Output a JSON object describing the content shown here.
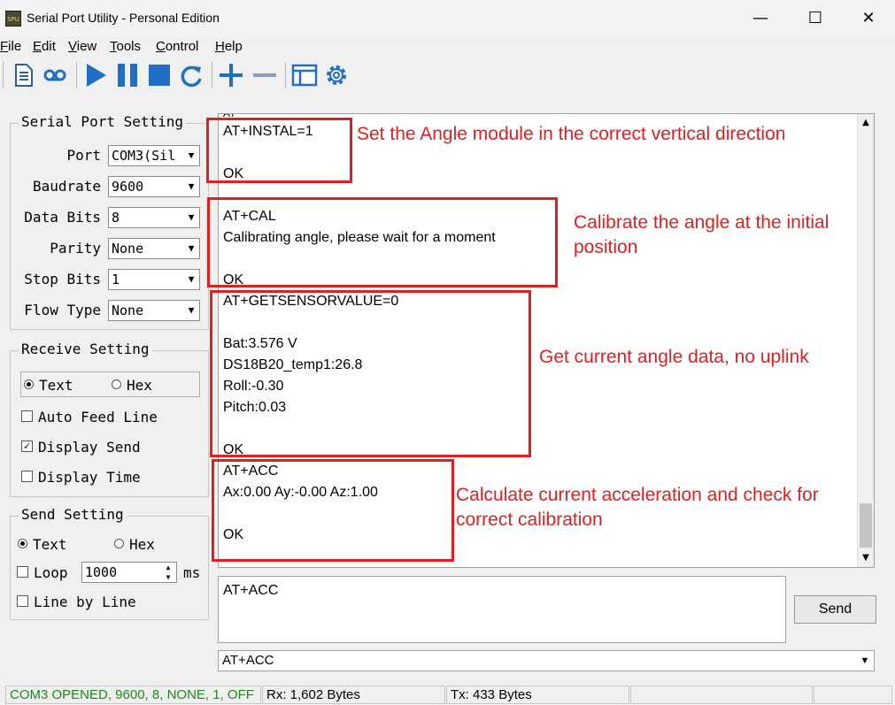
{
  "window": {
    "title": "Serial Port Utility - Personal Edition",
    "icon_text": "SPU",
    "minimize": "—",
    "maximize": "☐",
    "close": "✕"
  },
  "menu": [
    {
      "u": "F",
      "rest": "ile"
    },
    {
      "u": "E",
      "rest": "dit"
    },
    {
      "u": "V",
      "rest": "iew"
    },
    {
      "u": "T",
      "rest": "ools"
    },
    {
      "u": "C",
      "rest": "ontrol"
    },
    {
      "u": "H",
      "rest": "elp"
    }
  ],
  "toolbar": {
    "icons": [
      "document-icon",
      "record-icon",
      "play-icon",
      "pause-icon",
      "stop-icon",
      "refresh-icon",
      "plus-icon",
      "minus-icon",
      "window-icon",
      "gear-icon"
    ],
    "accent": "#1f6fc5"
  },
  "serial_port_setting": {
    "title": "Serial Port Setting",
    "fields": [
      {
        "label": "Port",
        "value": "COM3(Sil"
      },
      {
        "label": "Baudrate",
        "value": "9600"
      },
      {
        "label": "Data Bits",
        "value": "8"
      },
      {
        "label": "Parity",
        "value": "None"
      },
      {
        "label": "Stop Bits",
        "value": "1"
      },
      {
        "label": "Flow Type",
        "value": "None"
      }
    ]
  },
  "receive_setting": {
    "title": "Receive Setting",
    "text_label": "Text",
    "hex_label": "Hex",
    "auto_feed_line": "Auto Feed Line",
    "display_send": "Display Send",
    "display_time": "Display Time"
  },
  "send_setting": {
    "title": "Send Setting",
    "text_label": "Text",
    "hex_label": "Hex",
    "loop_label": "Loop",
    "loop_value": "1000",
    "loop_unit": "ms",
    "line_by_line": "Line by Line"
  },
  "receive_lines": [
    "AT+INSTAL=1",
    "",
    "OK",
    "",
    "AT+CAL",
    "Calibrating angle, please wait for a moment",
    "",
    "OK",
    "AT+GETSENSORVALUE=0",
    "",
    "Bat:3.576 V",
    "DS18B20_temp1:26.8",
    "Roll:-0.30",
    "Pitch:0.03",
    "",
    "OK",
    "AT+ACC",
    "Ax:0.00 Ay:-0.00 Az:1.00",
    "",
    "OK"
  ],
  "annotations": [
    {
      "lines": [
        "Set the Angle module in the correct vertical direction"
      ]
    },
    {
      "lines": [
        "Calibrate the angle at the initial",
        "position"
      ]
    },
    {
      "lines": [
        "Get current angle data, no uplink"
      ]
    },
    {
      "lines": [
        "Calculate current acceleration and check for",
        "correct calibration"
      ]
    }
  ],
  "annotation_color": "#e02020",
  "send": {
    "input_value": "AT+ACC",
    "button_label": "Send",
    "history_value": "AT+ACC"
  },
  "status": {
    "port": "COM3 OPENED, 9600, 8, NONE, 1, OFF",
    "rx": "Rx: 1,602 Bytes",
    "tx": "Tx: 433 Bytes",
    "port_color": "#1a8a1a"
  }
}
